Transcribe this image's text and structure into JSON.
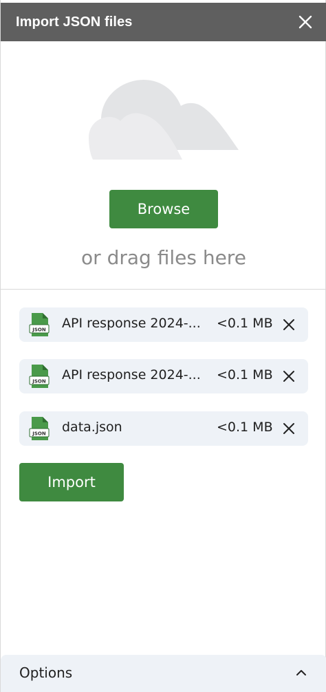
{
  "header": {
    "title": "Import JSON files",
    "close_icon": "close-icon"
  },
  "dropzone": {
    "illustration": "cloud-icon",
    "browse_label": "Browse",
    "drag_text": "or drag files here"
  },
  "files": [
    {
      "name": "API response 2024-...",
      "size": "<0.1 MB",
      "icon": "json-file-icon",
      "icon_label": "JSON"
    },
    {
      "name": "API response 2024-...",
      "size": "<0.1 MB",
      "icon": "json-file-icon",
      "icon_label": "JSON"
    },
    {
      "name": "data.json",
      "size": "<0.1 MB",
      "icon": "json-file-icon",
      "icon_label": "JSON"
    }
  ],
  "actions": {
    "import_label": "Import"
  },
  "options": {
    "label": "Options",
    "chevron_icon": "chevron-up-icon"
  },
  "colors": {
    "header_bg": "#5f5f5f",
    "primary_green": "#3f8a40",
    "file_row_bg": "#eef2f7",
    "cloud_gray": "#e3e4e6"
  }
}
